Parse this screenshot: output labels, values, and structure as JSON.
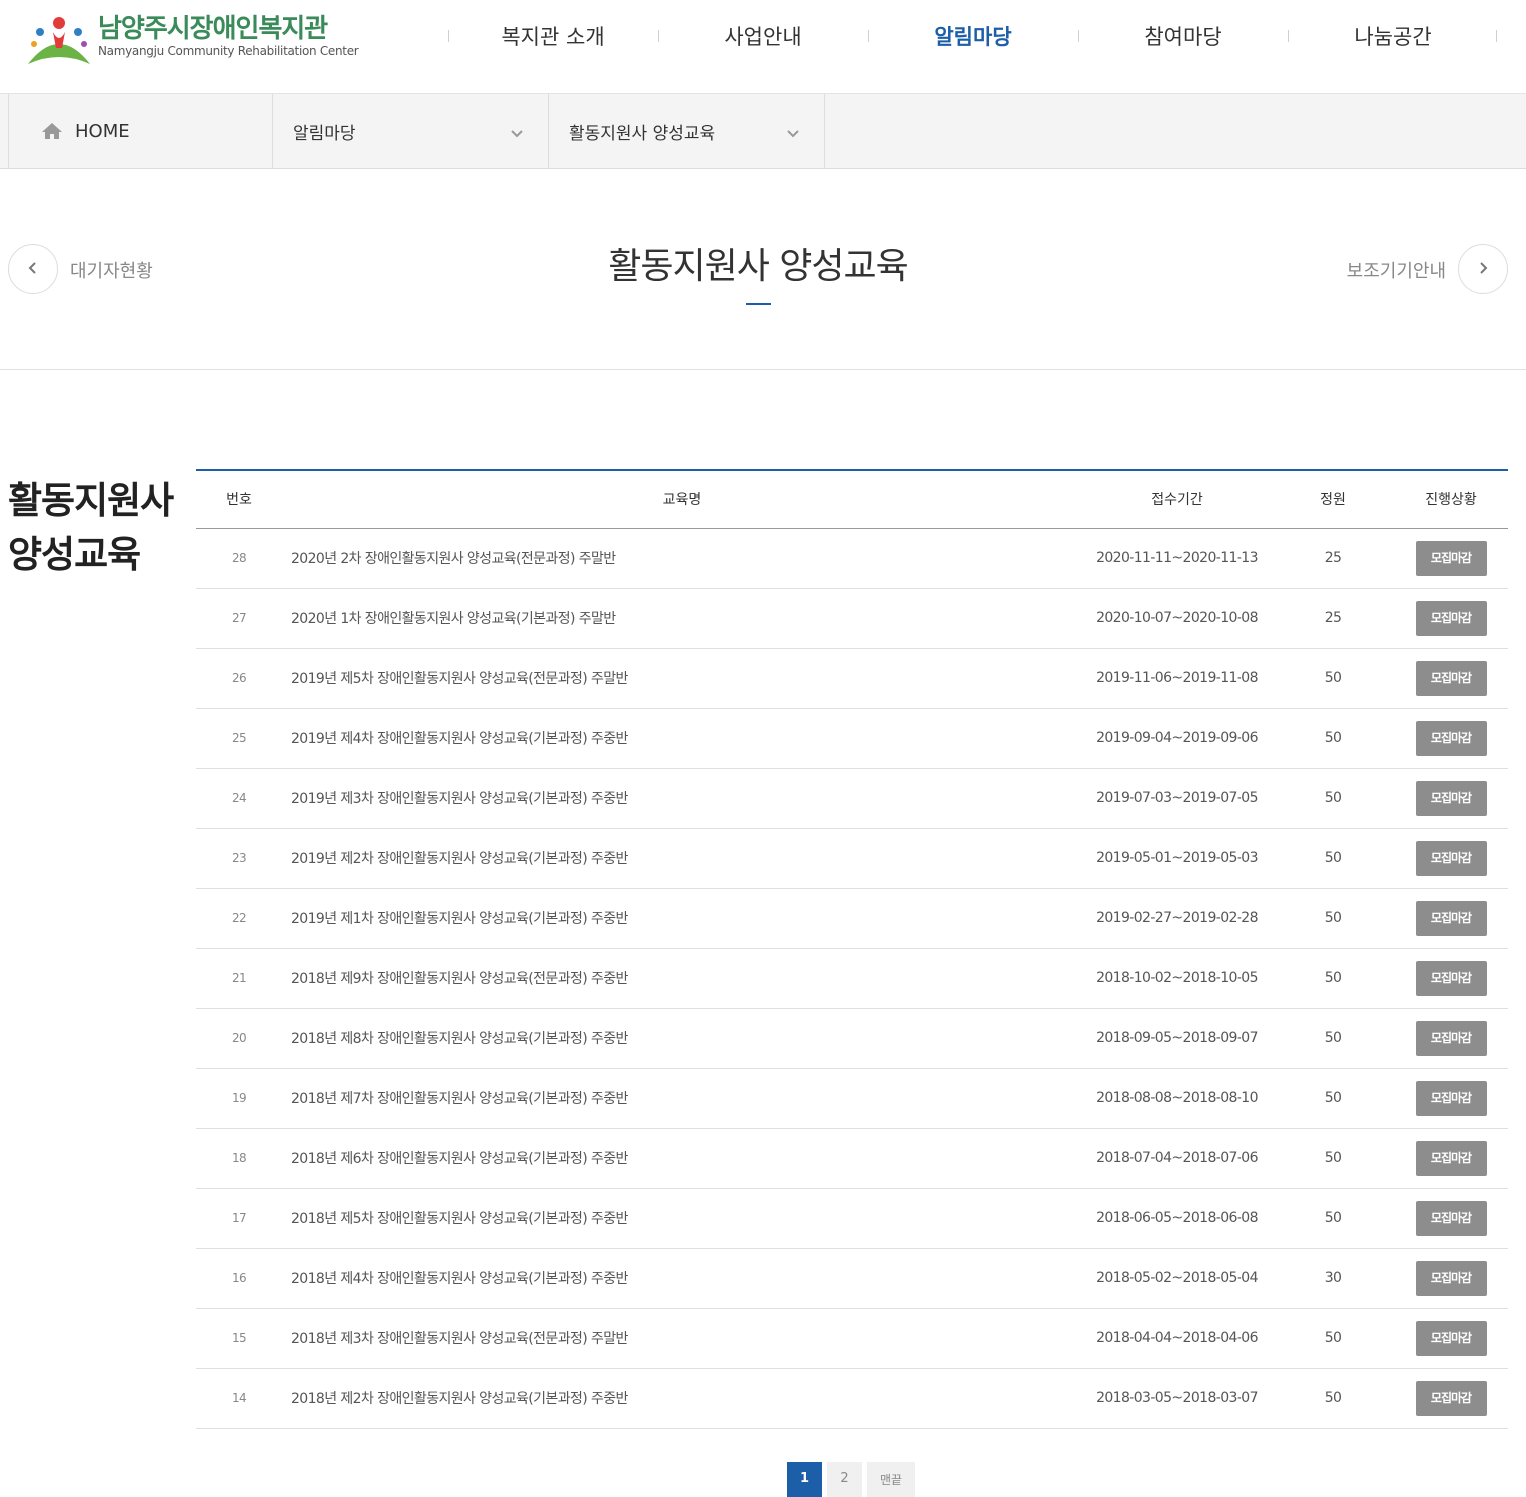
{
  "header": {
    "logo_title": "남양주시장애인복지관",
    "logo_subtitle": "Namyangju Community Rehabilitation Center",
    "nav": [
      {
        "label": "복지관 소개"
      },
      {
        "label": "사업안내"
      },
      {
        "label": "알림마당"
      },
      {
        "label": "참여마당"
      },
      {
        "label": "나눔공간"
      }
    ],
    "active_nav": "알림마당",
    "accent_color": "#1c5ea8"
  },
  "location": {
    "home": "HOME",
    "level1": "알림마당",
    "level2": "활동지원사 양성교육"
  },
  "page": {
    "title": "활동지원사 양성교육",
    "prev_label": "대기자현황",
    "next_label": "보조기기안내",
    "side_heading_line1": "활동지원사",
    "side_heading_line2": "양성교육"
  },
  "table": {
    "headers": {
      "num": "번호",
      "title": "교육명",
      "period": "접수기간",
      "capacity": "정원",
      "status": "진행상황"
    },
    "rows": [
      {
        "num": "28",
        "title": "2020년 2차 장애인활동지원사 양성교육(전문과정) 주말반",
        "period": "2020-11-11~2020-11-13",
        "capacity": "25",
        "status": "모집마감"
      },
      {
        "num": "27",
        "title": "2020년 1차 장애인활동지원사 양성교육(기본과정) 주말반",
        "period": "2020-10-07~2020-10-08",
        "capacity": "25",
        "status": "모집마감"
      },
      {
        "num": "26",
        "title": "2019년 제5차 장애인활동지원사 양성교육(전문과정) 주말반",
        "period": "2019-11-06~2019-11-08",
        "capacity": "50",
        "status": "모집마감"
      },
      {
        "num": "25",
        "title": "2019년 제4차 장애인활동지원사 양성교육(기본과정) 주중반",
        "period": "2019-09-04~2019-09-06",
        "capacity": "50",
        "status": "모집마감"
      },
      {
        "num": "24",
        "title": "2019년 제3차 장애인활동지원사 양성교육(기본과정) 주중반",
        "period": "2019-07-03~2019-07-05",
        "capacity": "50",
        "status": "모집마감"
      },
      {
        "num": "23",
        "title": "2019년 제2차 장애인활동지원사 양성교육(기본과정) 주중반",
        "period": "2019-05-01~2019-05-03",
        "capacity": "50",
        "status": "모집마감"
      },
      {
        "num": "22",
        "title": "2019년 제1차 장애인활동지원사 양성교육(기본과정) 주중반",
        "period": "2019-02-27~2019-02-28",
        "capacity": "50",
        "status": "모집마감"
      },
      {
        "num": "21",
        "title": "2018년 제9차 장애인활동지원사 양성교육(전문과정) 주중반",
        "period": "2018-10-02~2018-10-05",
        "capacity": "50",
        "status": "모집마감"
      },
      {
        "num": "20",
        "title": "2018년 제8차 장애인활동지원사 양성교육(기본과정) 주중반",
        "period": "2018-09-05~2018-09-07",
        "capacity": "50",
        "status": "모집마감"
      },
      {
        "num": "19",
        "title": "2018년 제7차 장애인활동지원사 양성교육(기본과정) 주중반",
        "period": "2018-08-08~2018-08-10",
        "capacity": "50",
        "status": "모집마감"
      },
      {
        "num": "18",
        "title": "2018년 제6차 장애인활동지원사 양성교육(기본과정) 주중반",
        "period": "2018-07-04~2018-07-06",
        "capacity": "50",
        "status": "모집마감"
      },
      {
        "num": "17",
        "title": "2018년 제5차 장애인활동지원사 양성교육(기본과정) 주중반",
        "period": "2018-06-05~2018-06-08",
        "capacity": "50",
        "status": "모집마감"
      },
      {
        "num": "16",
        "title": "2018년 제4차 장애인활동지원사 양성교육(기본과정) 주중반",
        "period": "2018-05-02~2018-05-04",
        "capacity": "30",
        "status": "모집마감"
      },
      {
        "num": "15",
        "title": "2018년 제3차 장애인활동지원사 양성교육(전문과정) 주말반",
        "period": "2018-04-04~2018-04-06",
        "capacity": "50",
        "status": "모집마감"
      },
      {
        "num": "14",
        "title": "2018년 제2차 장애인활동지원사 양성교육(기본과정) 주중반",
        "period": "2018-03-05~2018-03-07",
        "capacity": "50",
        "status": "모집마감"
      }
    ]
  },
  "pagination": {
    "pages": [
      "1",
      "2"
    ],
    "current": "1",
    "last_label": "맨끝"
  }
}
